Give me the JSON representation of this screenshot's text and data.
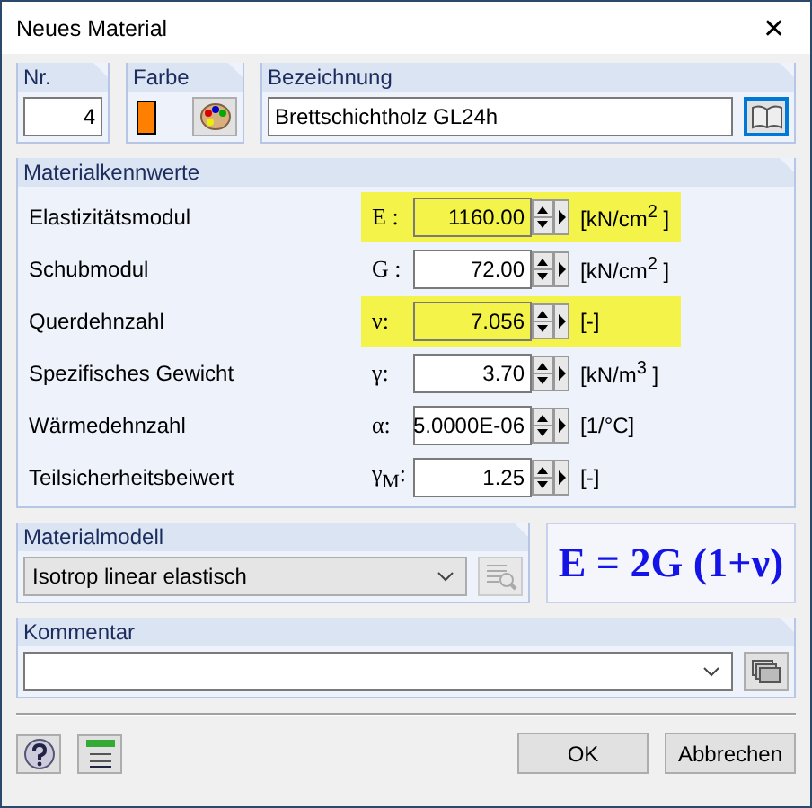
{
  "window": {
    "title": "Neues Material",
    "close": "✕"
  },
  "nr": {
    "label": "Nr.",
    "value": "4"
  },
  "farbe": {
    "label": "Farbe",
    "color": "#ff8000"
  },
  "bezeichnung": {
    "label": "Bezeichnung",
    "value": "Brettschichtholz GL24h"
  },
  "materialkennwerte": {
    "label": "Materialkennwerte",
    "rows": [
      {
        "label": "Elastizitätsmodul",
        "symbol": "E :",
        "value": "1160.00",
        "unit": "[kN/cm$^{2}$ ]",
        "highlighted": true
      },
      {
        "label": "Schubmodul",
        "symbol": "G :",
        "value": "72.00",
        "unit": "[kN/cm$^{2}$ ]",
        "highlighted": false
      },
      {
        "label": "Querdehnzahl",
        "symbol": "ν:",
        "value": "7.056",
        "unit": "[-]",
        "highlighted": true
      },
      {
        "label": "Spezifisches Gewicht",
        "symbol": "γ:",
        "value": "3.70",
        "unit": "[kN/m$^{3}$ ]",
        "highlighted": false
      },
      {
        "label": "Wärmedehnzahl",
        "symbol": "α:",
        "value": "5.0000E-06",
        "unit": "[1/°C]",
        "highlighted": false
      },
      {
        "label": "Teilsicherheitsbeiwert",
        "symbol": "γ$_{M}$:",
        "value": "1.25",
        "unit": "[-]",
        "highlighted": false
      }
    ]
  },
  "materialmodell": {
    "label": "Materialmodell",
    "value": "Isotrop linear elastisch"
  },
  "formula": "E = 2G (1+ν)",
  "kommentar": {
    "label": "Kommentar"
  },
  "buttons": [
    {
      "label": "OK"
    },
    {
      "label": "Abbrechen"
    }
  ]
}
